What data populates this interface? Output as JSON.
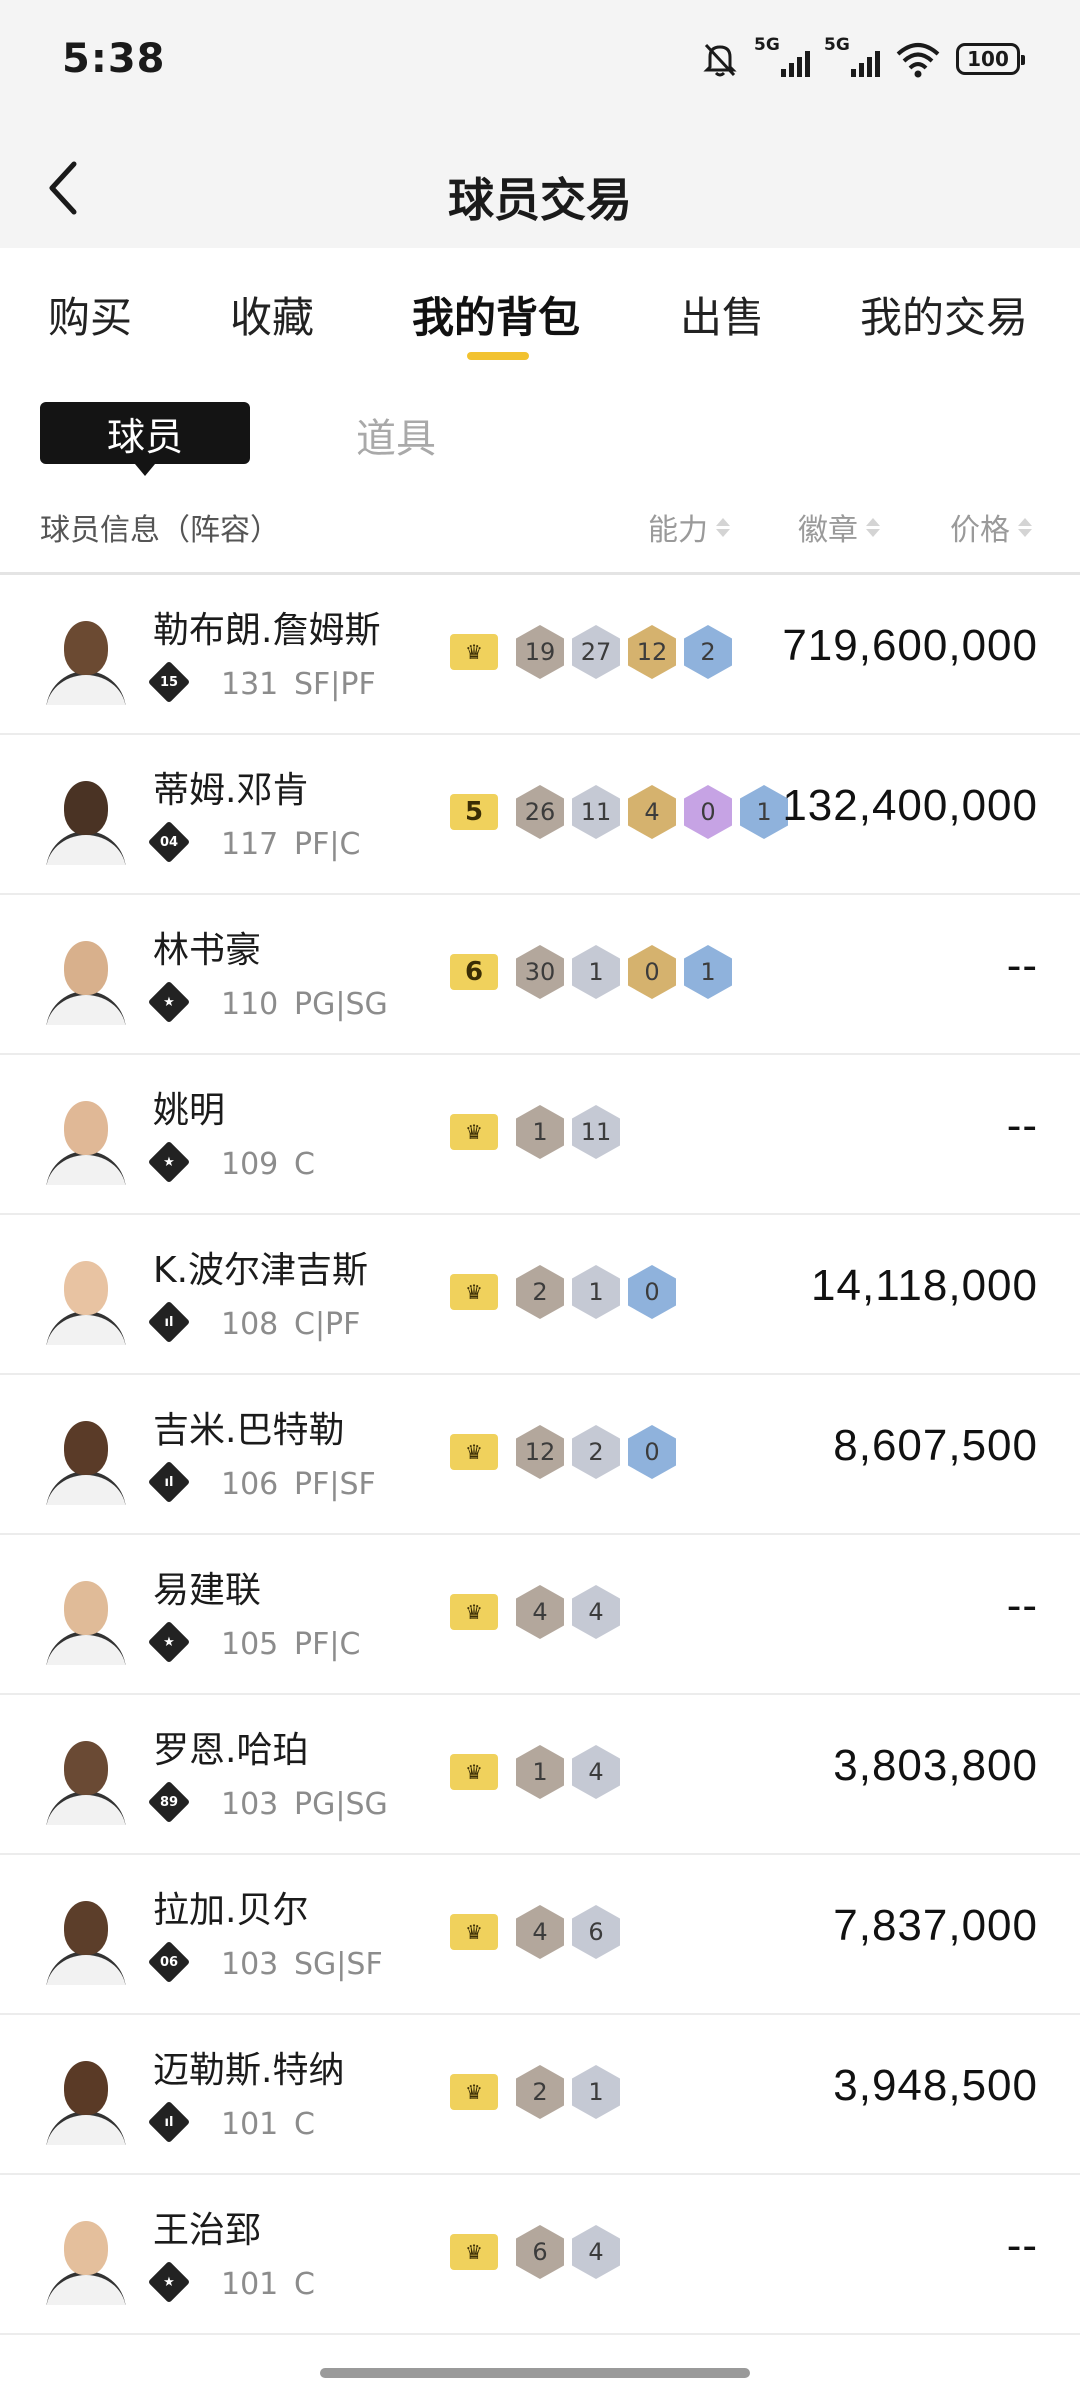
{
  "status_bar": {
    "time": "5:38",
    "network1": "5G",
    "network2": "5G",
    "battery": "100",
    "icons": [
      "mute-bell-icon",
      "signal-icon",
      "signal-icon",
      "wifi-icon",
      "battery-icon"
    ]
  },
  "header": {
    "title": "球员交易",
    "back_icon": "back-chevron-icon"
  },
  "tabs": [
    {
      "label": "购买"
    },
    {
      "label": "收藏"
    },
    {
      "label": "我的背包",
      "active": true
    },
    {
      "label": "出售"
    },
    {
      "label": "我的交易"
    }
  ],
  "subtabs": {
    "active": "球员",
    "other": "道具"
  },
  "columns": {
    "info": "球员信息（阵容）",
    "ability": "能力",
    "badge": "徽章",
    "price": "价格"
  },
  "accent_color": "#f2c230",
  "players": [
    {
      "name": "勒布朗.詹姆斯",
      "tier": "15",
      "rating": "131",
      "pos": "SF|PF",
      "crown": "crown",
      "badges": [
        [
          "19",
          "bronze"
        ],
        [
          "27",
          "silver"
        ],
        [
          "12",
          "gold"
        ],
        [
          "2",
          "blue"
        ]
      ],
      "price": "719,600,000"
    },
    {
      "name": "蒂姆.邓肯",
      "tier": "04",
      "rating": "117",
      "pos": "PF|C",
      "crown": "5",
      "badges": [
        [
          "26",
          "bronze"
        ],
        [
          "11",
          "silver"
        ],
        [
          "4",
          "gold"
        ],
        [
          "0",
          "purple"
        ],
        [
          "1",
          "blue"
        ]
      ],
      "price": "132,400,000"
    },
    {
      "name": "林书豪",
      "tier": "★",
      "rating": "110",
      "pos": "PG|SG",
      "crown": "6",
      "badges": [
        [
          "30",
          "bronze"
        ],
        [
          "1",
          "silver"
        ],
        [
          "0",
          "gold"
        ],
        [
          "1",
          "blue"
        ]
      ],
      "price": "--"
    },
    {
      "name": "姚明",
      "tier": "★",
      "rating": "109",
      "pos": "C",
      "crown": "crown",
      "badges": [
        [
          "1",
          "bronze"
        ],
        [
          "11",
          "silver"
        ]
      ],
      "price": "--"
    },
    {
      "name": "K.波尔津吉斯",
      "tier": "ıl",
      "rating": "108",
      "pos": "C|PF",
      "crown": "crown",
      "badges": [
        [
          "2",
          "bronze"
        ],
        [
          "1",
          "silver"
        ],
        [
          "0",
          "blue"
        ]
      ],
      "price": "14,118,000"
    },
    {
      "name": "吉米.巴特勒",
      "tier": "ıl",
      "rating": "106",
      "pos": "PF|SF",
      "crown": "crown",
      "badges": [
        [
          "12",
          "bronze"
        ],
        [
          "2",
          "silver"
        ],
        [
          "0",
          "blue"
        ]
      ],
      "price": "8,607,500"
    },
    {
      "name": "易建联",
      "tier": "★",
      "rating": "105",
      "pos": "PF|C",
      "crown": "crown",
      "badges": [
        [
          "4",
          "bronze"
        ],
        [
          "4",
          "silver"
        ]
      ],
      "price": "--"
    },
    {
      "name": "罗恩.哈珀",
      "tier": "89",
      "rating": "103",
      "pos": "PG|SG",
      "crown": "crown",
      "badges": [
        [
          "1",
          "bronze"
        ],
        [
          "4",
          "silver"
        ]
      ],
      "price": "3,803,800"
    },
    {
      "name": "拉加.贝尔",
      "tier": "06",
      "rating": "103",
      "pos": "SG|SF",
      "crown": "crown",
      "badges": [
        [
          "4",
          "bronze"
        ],
        [
          "6",
          "silver"
        ]
      ],
      "price": "7,837,000"
    },
    {
      "name": "迈勒斯.特纳",
      "tier": "ıl",
      "rating": "101",
      "pos": "C",
      "crown": "crown",
      "badges": [
        [
          "2",
          "bronze"
        ],
        [
          "1",
          "silver"
        ]
      ],
      "price": "3,948,500"
    },
    {
      "name": "王治郅",
      "tier": "★",
      "rating": "101",
      "pos": "C",
      "crown": "crown",
      "badges": [
        [
          "6",
          "bronze"
        ],
        [
          "4",
          "silver"
        ]
      ],
      "price": "--"
    }
  ]
}
